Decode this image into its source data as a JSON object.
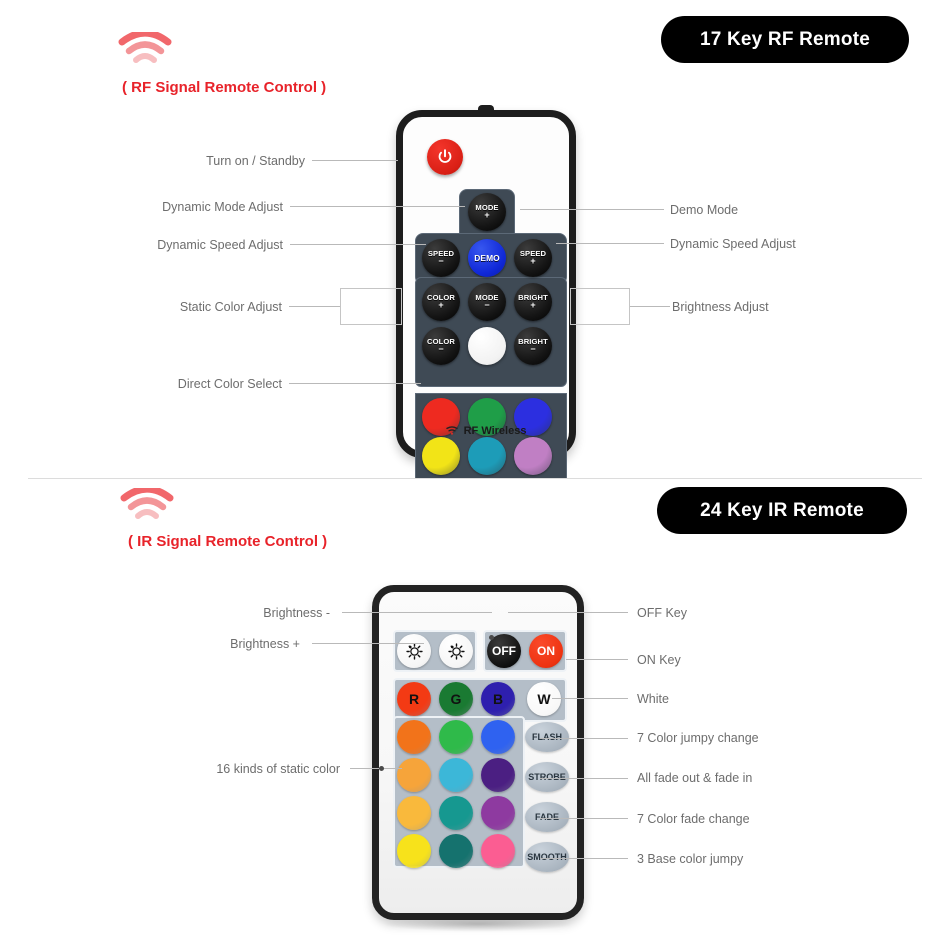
{
  "sections": [
    {
      "id": "rf",
      "badge": "17 Key RF Remote",
      "signal_caption": "( RF Signal Remote Control )",
      "wifi_icon": "wifi-signal-icon",
      "footer_text": "RF Wireless",
      "power_icon": "power-icon",
      "keys": [
        {
          "name": "power",
          "line1": "",
          "line2": ""
        },
        {
          "name": "mode-plus",
          "line1": "MODE",
          "line2": "+"
        },
        {
          "name": "speed-minus",
          "line1": "SPEED",
          "line2": "−"
        },
        {
          "name": "demo",
          "line1": "DEMO",
          "line2": ""
        },
        {
          "name": "speed-plus",
          "line1": "SPEED",
          "line2": "+"
        },
        {
          "name": "color-plus",
          "line1": "COLOR",
          "line2": "+"
        },
        {
          "name": "mode-minus",
          "line1": "MODE",
          "line2": "−"
        },
        {
          "name": "bright-plus",
          "line1": "BRIGHT",
          "line2": "+"
        },
        {
          "name": "color-minus",
          "line1": "COLOR",
          "line2": "−"
        },
        {
          "name": "white",
          "line1": "",
          "line2": ""
        },
        {
          "name": "bright-minus",
          "line1": "BRIGHT",
          "line2": "−"
        }
      ],
      "color_keys": [
        {
          "name": "red",
          "color": "#ee2a20"
        },
        {
          "name": "green",
          "color": "#1f9e48"
        },
        {
          "name": "blue",
          "color": "#2c2fe0"
        },
        {
          "name": "yellow",
          "color": "#f2e417"
        },
        {
          "name": "cyan",
          "color": "#1d9cb8"
        },
        {
          "name": "orchid",
          "color": "#c07fc4"
        }
      ],
      "callouts_left": [
        {
          "text": "Turn on / Standby"
        },
        {
          "text": "Dynamic Mode Adjust"
        },
        {
          "text": "Dynamic Speed Adjust"
        },
        {
          "text": "Static Color Adjust"
        },
        {
          "text": "Direct Color Select"
        }
      ],
      "callouts_right": [
        {
          "text": "Demo Mode"
        },
        {
          "text": "Dynamic Speed Adjust"
        },
        {
          "text": "Brightness Adjust"
        }
      ]
    },
    {
      "id": "ir",
      "badge": "24 Key IR Remote",
      "signal_caption": "( IR Signal Remote Control )",
      "wifi_icon": "wifi-signal-icon",
      "top_keys": [
        {
          "name": "brightness-up",
          "label": "",
          "icon": "sun-bright-icon"
        },
        {
          "name": "brightness-down",
          "label": "",
          "icon": "sun-dim-icon"
        },
        {
          "name": "off",
          "label": "OFF"
        },
        {
          "name": "on",
          "label": "ON"
        }
      ],
      "rgbw_row": [
        {
          "name": "red-key",
          "label": "R",
          "color": "#f33a14"
        },
        {
          "name": "green-key",
          "label": "G",
          "color": "#1a7a32"
        },
        {
          "name": "blue-key",
          "label": "B",
          "color": "#2e1fae"
        },
        {
          "name": "white-key",
          "label": "W",
          "color": "#ffffff"
        }
      ],
      "color_grid": [
        [
          "#f2731a",
          "#2fba4a",
          "#2f62f0"
        ],
        [
          "#f6a43a",
          "#3cb7d8",
          "#4b1f82"
        ],
        [
          "#f9b93c",
          "#169890",
          "#8e3aa0"
        ],
        [
          "#f7e21b",
          "#15726e",
          "#fb5d92"
        ]
      ],
      "effect_keys": [
        {
          "name": "flash",
          "label": "FLASH"
        },
        {
          "name": "strobe",
          "label": "STROBE"
        },
        {
          "name": "fade",
          "label": "FADE"
        },
        {
          "name": "smooth",
          "label": "SMOOTH"
        }
      ],
      "callouts_left": [
        {
          "text": "Brightness -"
        },
        {
          "text": "Brightness +"
        },
        {
          "text": "16 kinds of static color"
        }
      ],
      "callouts_right": [
        {
          "text": "OFF Key"
        },
        {
          "text": "ON Key"
        },
        {
          "text": "White"
        },
        {
          "text": "7 Color jumpy change"
        },
        {
          "text": "All fade out & fade in"
        },
        {
          "text": "7 Color fade change"
        },
        {
          "text": "3 Base color jumpy"
        }
      ]
    }
  ],
  "colors": {
    "accent_red": "#e8232a",
    "badge_bg": "#000000",
    "lead_line": "#b9b9b9",
    "callout_text": "#6d6d6d"
  }
}
